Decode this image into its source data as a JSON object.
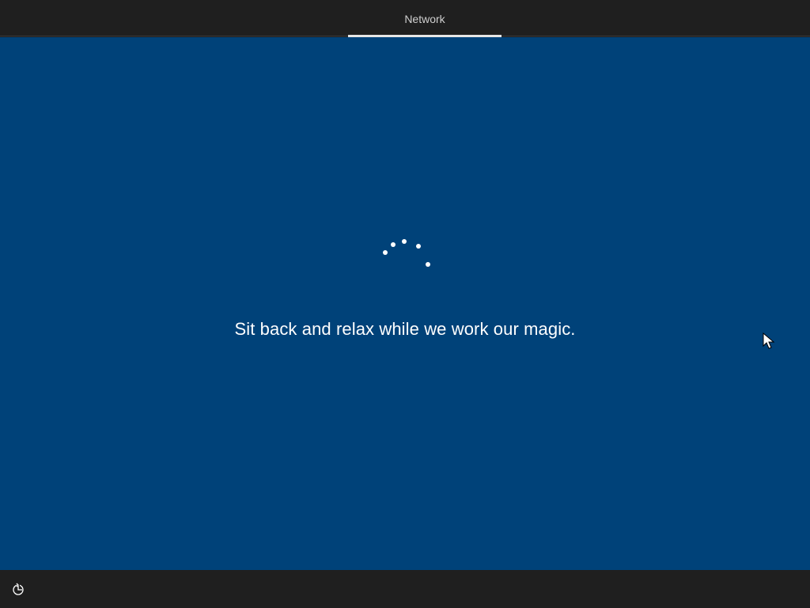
{
  "header": {
    "active_tab": "Network"
  },
  "main": {
    "message": "Sit back and relax while we work our magic.",
    "spinner_icon": "loading-dots-icon"
  },
  "footer": {
    "accessibility_icon": "ease-of-access-icon"
  },
  "colors": {
    "background": "#004279",
    "bar": "#1f1f1f",
    "text": "#ffffff",
    "tab_text": "#cfcfcf"
  }
}
